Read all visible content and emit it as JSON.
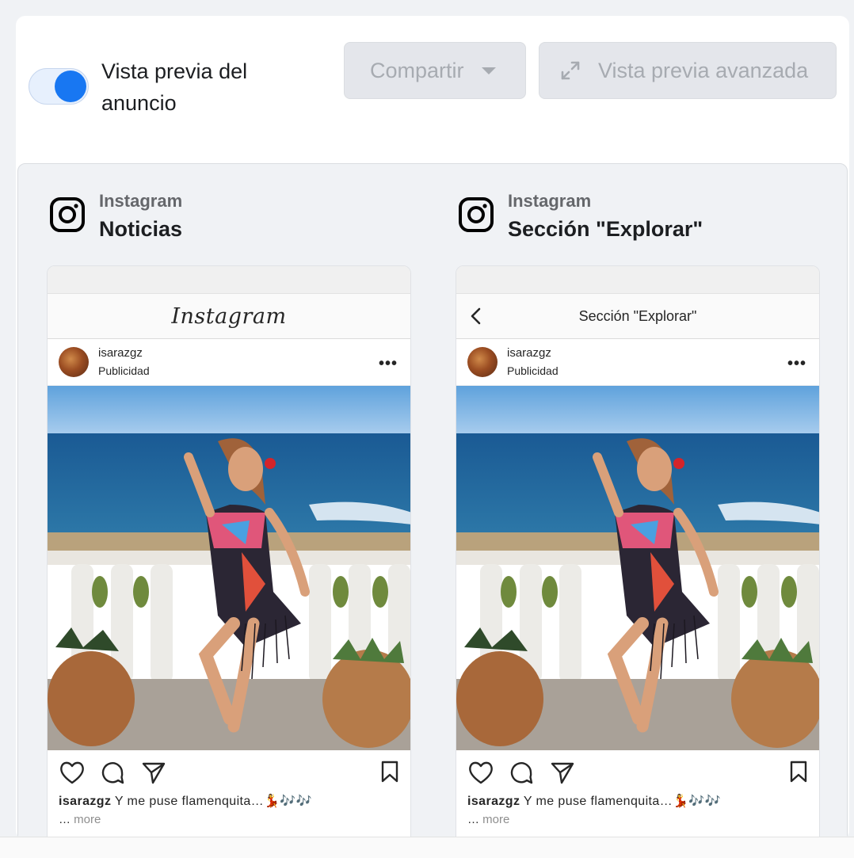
{
  "toolbar": {
    "toggle_on": true,
    "toggle_label": "Vista previa del anuncio",
    "share_label": "Compartir",
    "advanced_label": "Vista previa avanzada"
  },
  "placements": [
    {
      "platform": "Instagram",
      "title": "Noticias",
      "header_text": "Instagram",
      "username": "isarazgz",
      "sponsored": "Publicidad",
      "caption_user": "isarazgz",
      "caption_text": "Y me puse flamenquita…💃🎶🎶",
      "more_prefix": "…",
      "more_label": "more"
    },
    {
      "platform": "Instagram",
      "title": "Sección \"Explorar\"",
      "header_text": "Sección \"Explorar\"",
      "username": "isarazgz",
      "sponsored": "Publicidad",
      "caption_user": "isarazgz",
      "caption_text": "Y me puse flamenquita…💃🎶🎶",
      "more_prefix": "…",
      "more_label": "more"
    }
  ],
  "colors": {
    "accent": "#1877f2",
    "button_bg": "#e4e6eb",
    "button_text": "#a7abb1",
    "panel_bg": "#f0f2f5"
  }
}
